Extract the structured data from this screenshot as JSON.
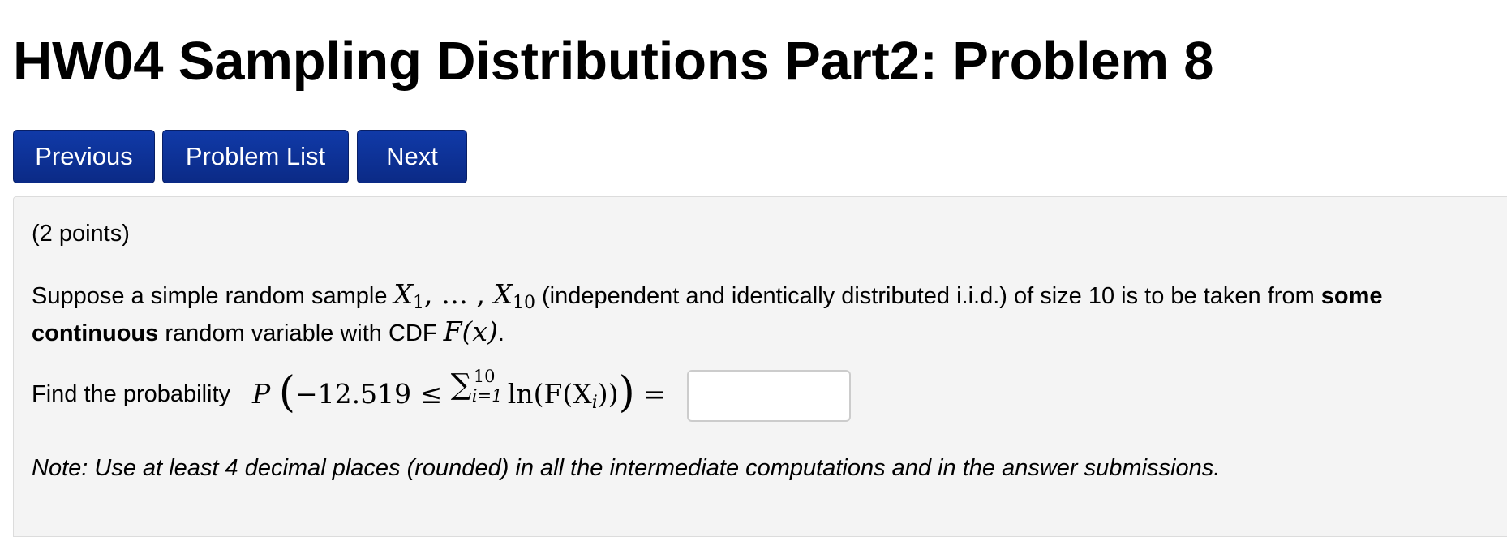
{
  "page": {
    "title": "HW04 Sampling Distributions Part2: Problem 8"
  },
  "nav": {
    "previous_label": "Previous",
    "problem_list_label": "Problem List",
    "next_label": "Next"
  },
  "problem": {
    "points": "(2 points)",
    "statement": {
      "intro": "Suppose a simple random sample ",
      "sample_first": "X",
      "sample_first_sub": "1",
      "sample_sep": ", … , ",
      "sample_last": "X",
      "sample_last_sub": "10",
      "middle": " (independent and identically distributed i.i.d.) of size 10 is to be taken from ",
      "bold_phrase": "some continuous",
      "tail": " random variable with CDF ",
      "cdf": "F(x)",
      "end": "."
    },
    "find": {
      "label": "Find the probability",
      "prob_symbol": "P",
      "lower_bound": "−12.519 ≤",
      "sum_symbol": "∑",
      "sum_upper": "10",
      "sum_lower": "i=1",
      "summand": "ln(F(X",
      "summand_sub": "i",
      "summand_close": "))",
      "equals": "=",
      "answer_value": ""
    },
    "note": "Note: Use at least 4 decimal places (rounded) in all the intermediate computations and in the answer submissions."
  }
}
